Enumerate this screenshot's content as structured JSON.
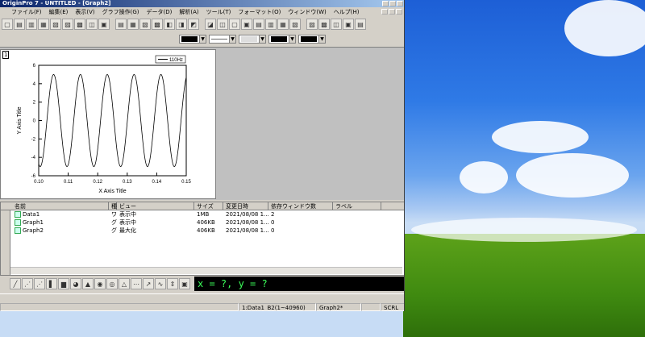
{
  "window": {
    "title": "OriginPro 7 - UNTITLED - [Graph2]"
  },
  "menu": [
    "ファイル(F)",
    "編集(E)",
    "表示(V)",
    "グラフ操作(G)",
    "データ(D)",
    "解析(A)",
    "ツール(T)",
    "フォーマット(O)",
    "ウィンドウ(W)",
    "ヘルプ(H)"
  ],
  "graph": {
    "layer": "1",
    "legend": "110Hz",
    "xlabel": "X Axis Title",
    "ylabel": "Y Axis Title",
    "xticks": [
      "0.10",
      "0.11",
      "0.12",
      "0.13",
      "0.14",
      "0.15"
    ],
    "yticks": [
      "6",
      "4",
      "2",
      "0",
      "-2",
      "-4",
      "-6"
    ]
  },
  "chart_data": {
    "type": "line",
    "xlim": [
      0.1,
      0.15
    ],
    "ylim": [
      -6,
      6
    ],
    "series": [
      {
        "name": "110Hz",
        "amplitude": 5,
        "frequency_hz": 110
      }
    ],
    "xlabel": "X Axis Title",
    "ylabel": "Y Axis Title",
    "legend": "top-right",
    "grid": false
  },
  "explorer": {
    "headers": [
      "名前",
      "種",
      "ビュー",
      "サイズ",
      "変更日時",
      "依存ウィンドウ数",
      "ラベル"
    ],
    "rows": [
      {
        "name": "Data1",
        "kind": "ワ",
        "view": "表示中",
        "size": "1MB",
        "date": "2021/08/08 1...",
        "deps": "2",
        "label": ""
      },
      {
        "name": "Graph1",
        "kind": "グ",
        "view": "表示中",
        "size": "406KB",
        "date": "2021/08/08 1...",
        "deps": "0",
        "label": ""
      },
      {
        "name": "Graph2",
        "kind": "グ",
        "view": "最大化",
        "size": "406KB",
        "date": "2021/08/08 1...",
        "deps": "0",
        "label": ""
      }
    ]
  },
  "coords": "x = ?, y = ?",
  "status": {
    "col": "1:Data1_B2(1~40960)",
    "graph": "Graph2*",
    "scrl": "SCRL"
  }
}
